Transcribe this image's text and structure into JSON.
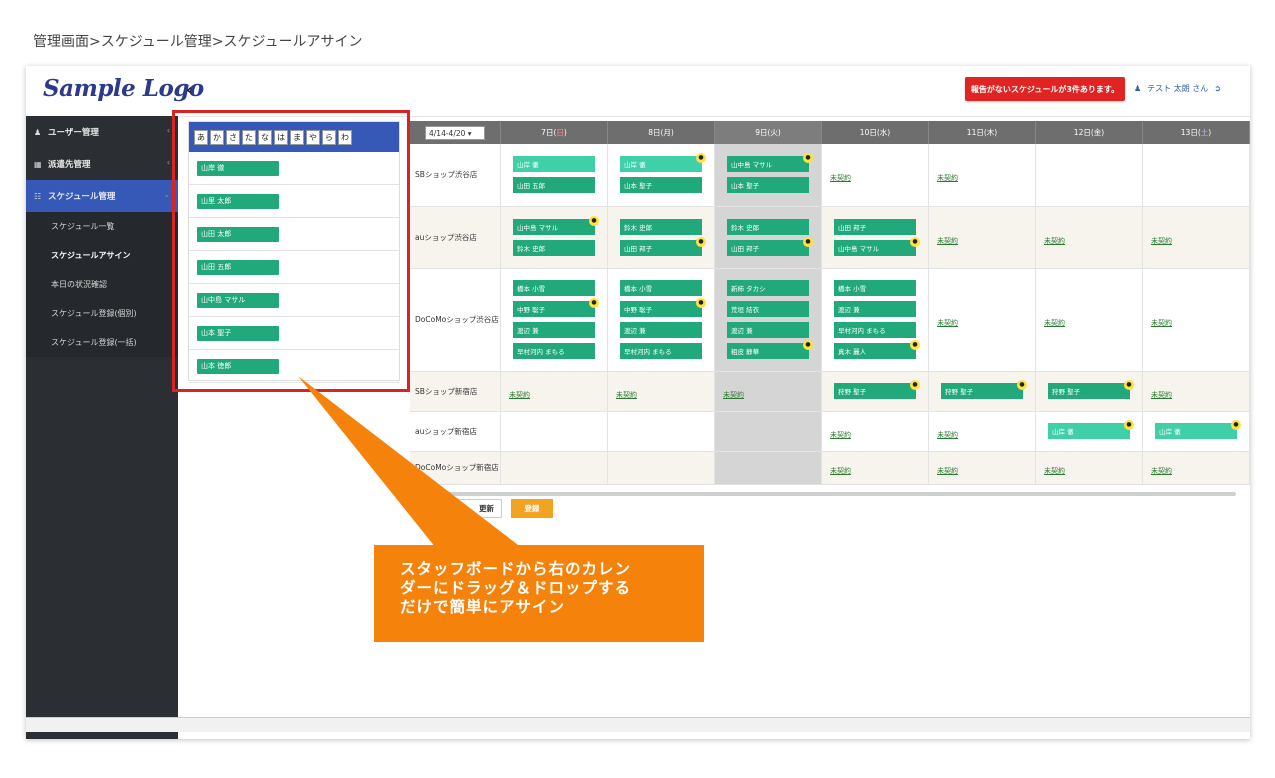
{
  "caption": "管理画面>スケジュール管理>スケジュールアサイン",
  "header": {
    "logo": "Sample Logo",
    "collapse_icon": "‹",
    "alert": "報告がないスケジュールが3件あります。",
    "user": "テスト 太朗 さん"
  },
  "sidebar": {
    "items": [
      {
        "icon": "user-icon",
        "label": "ユーザー管理"
      },
      {
        "icon": "building-icon",
        "label": "派遣先管理"
      },
      {
        "icon": "calendar-icon",
        "label": "スケジュール管理"
      }
    ],
    "subitems": [
      "スケジュール一覧",
      "スケジュールアサイン",
      "本日の状況確認",
      "スケジュール登録(個別)",
      "スケジュール登録(一括)"
    ]
  },
  "staff_board": {
    "kana": [
      "あ",
      "か",
      "さ",
      "た",
      "な",
      "は",
      "ま",
      "や",
      "ら",
      "わ"
    ],
    "staff": [
      "山岸 徹",
      "山里 太郎",
      "山田 太郎",
      "山田 五郎",
      "山中島 マサル",
      "山本 聖子",
      "山本 徳郎"
    ]
  },
  "calendar": {
    "week_select": "4/14-4/20",
    "days": [
      {
        "label": "7日(",
        "dow": "日",
        "close": ")",
        "type": "sun"
      },
      {
        "label": "8日(月)",
        "dow": "",
        "close": "",
        "type": ""
      },
      {
        "label": "9日(火)",
        "dow": "",
        "close": "",
        "type": ""
      },
      {
        "label": "10日(水)",
        "dow": "",
        "close": "",
        "type": ""
      },
      {
        "label": "11日(木)",
        "dow": "",
        "close": "",
        "type": ""
      },
      {
        "label": "12日(金)",
        "dow": "",
        "close": "",
        "type": ""
      },
      {
        "label": "13日(",
        "dow": "土",
        "close": ")",
        "type": "sat"
      }
    ],
    "not_contracted": "未契約",
    "rows": [
      {
        "store": "SBショップ渋谷店",
        "alt": false,
        "height": 62,
        "cells": [
          [
            {
              "n": "山岸 徹",
              "light": true
            },
            {
              "n": "山田 五郎"
            }
          ],
          [
            {
              "n": "山岸 徹",
              "light": true,
              "b": true
            },
            {
              "n": "山本 聖子"
            }
          ],
          [
            {
              "n": "山中島 マサル",
              "b": true
            },
            {
              "n": "山本 聖子"
            }
          ],
          "nc",
          "nc",
          [],
          []
        ]
      },
      {
        "store": "auショップ渋谷店",
        "alt": true,
        "height": 62,
        "cells": [
          [
            {
              "n": "山中島 マサル",
              "b": true
            },
            {
              "n": "鈴木 史郎"
            }
          ],
          [
            {
              "n": "鈴木 史郎"
            },
            {
              "n": "山田 邦子",
              "b": true
            }
          ],
          [
            {
              "n": "鈴木 史郎"
            },
            {
              "n": "山田 邦子",
              "b": true
            }
          ],
          [
            {
              "n": "山田 邦子"
            },
            {
              "n": "山中島 マサル",
              "b": true
            }
          ],
          "nc",
          "nc",
          "nc"
        ]
      },
      {
        "store": "DoCoMoショップ渋谷店",
        "alt": false,
        "height": 103,
        "cells": [
          [
            {
              "n": "橋本 小雪"
            },
            {
              "n": "中野 聡子",
              "b": true
            },
            {
              "n": "渡辺 兼"
            },
            {
              "n": "早村河内 まもる"
            }
          ],
          [
            {
              "n": "橋本 小雪"
            },
            {
              "n": "中野 聡子",
              "b": true
            },
            {
              "n": "渡辺 兼"
            },
            {
              "n": "早村河内 まもる"
            }
          ],
          [
            {
              "n": "新柿 タカシ"
            },
            {
              "n": "荒垣 結衣"
            },
            {
              "n": "渡辺 兼"
            },
            {
              "n": "粗皮 静華",
              "b": true
            }
          ],
          [
            {
              "n": "橋本 小雪"
            },
            {
              "n": "渡辺 兼"
            },
            {
              "n": "早村河内 まもる"
            },
            {
              "n": "真木 麗人",
              "b": true
            }
          ],
          "nc",
          "nc",
          "nc"
        ]
      },
      {
        "store": "SBショップ新宿店",
        "alt": true,
        "height": 40,
        "cells": [
          "nc",
          "nc",
          "nc",
          [
            {
              "n": "狩野 聖子",
              "b": true
            }
          ],
          [
            {
              "n": "狩野 聖子",
              "b": true
            }
          ],
          [
            {
              "n": "狩野 聖子",
              "b": true
            }
          ],
          "nc"
        ]
      },
      {
        "store": "auショップ新宿店",
        "alt": false,
        "height": 40,
        "cells": [
          [],
          [],
          [],
          "nc",
          "nc",
          [
            {
              "n": "山岸 徹",
              "light": true,
              "b": true
            }
          ],
          [
            {
              "n": "山岸 徹",
              "light": true,
              "b": true
            }
          ]
        ]
      },
      {
        "store": "DoCoMoショップ新宿店",
        "alt": true,
        "height": 33,
        "cells": [
          [],
          [],
          [],
          "nc",
          "nc",
          "nc",
          "nc"
        ]
      }
    ]
  },
  "buttons": {
    "update": "更新",
    "submit": "登録"
  },
  "callout": {
    "lines": [
      "スタッフボードから右のカレン",
      "ダーにドラッグ＆ドロップする",
      "だけで簡単にアサイン"
    ],
    "color": "#f5820a"
  }
}
